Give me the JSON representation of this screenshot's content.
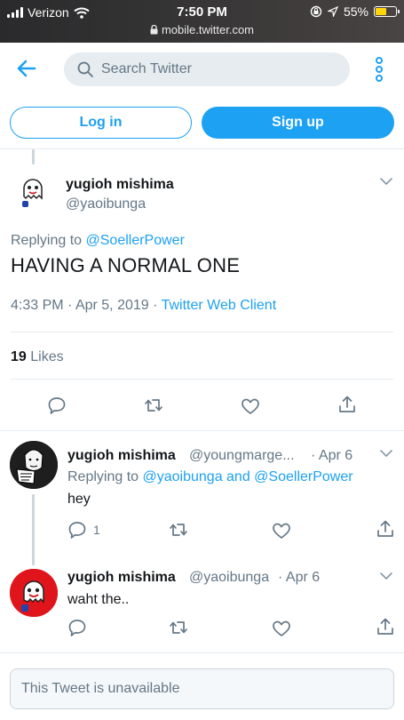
{
  "status_bar": {
    "carrier": "Verizon",
    "time": "7:50 PM",
    "url": "mobile.twitter.com",
    "battery": "55%",
    "battery_level": 0.55
  },
  "header": {
    "search_placeholder": "Search Twitter",
    "login_label": "Log in",
    "signup_label": "Sign up"
  },
  "main_tweet": {
    "name": "yugioh mishima",
    "handle": "@yaoibunga",
    "replying_prefix": "Replying to",
    "replying_to": "@SoellerPower",
    "text": "HAVING A NORMAL ONE",
    "time": "4:33 PM",
    "date": "Apr 5, 2019",
    "client": "Twitter Web Client",
    "likes_count": "19",
    "likes_label": "Likes"
  },
  "replies": [
    {
      "name": "yugioh mishima",
      "handle": "@youngmarge...",
      "date": "Apr 6",
      "replying_prefix": "Replying to",
      "replying_to": "@yaoibunga and @SoellerPower",
      "text": "hey",
      "reply_count": "1"
    },
    {
      "name": "yugioh mishima",
      "handle": "@yaoibunga",
      "date": "Apr 6",
      "text": "waht the.."
    }
  ],
  "unavailable_text": "This Tweet is unavailable",
  "colors": {
    "accent": "#1da1f2",
    "muted": "#657786",
    "border": "#e6ecf0"
  },
  "icons": [
    "wifi-icon",
    "lock-icon",
    "back-arrow-icon",
    "search-icon",
    "more-icon",
    "chevron-down-icon",
    "reply-icon",
    "retweet-icon",
    "like-icon",
    "share-icon"
  ]
}
